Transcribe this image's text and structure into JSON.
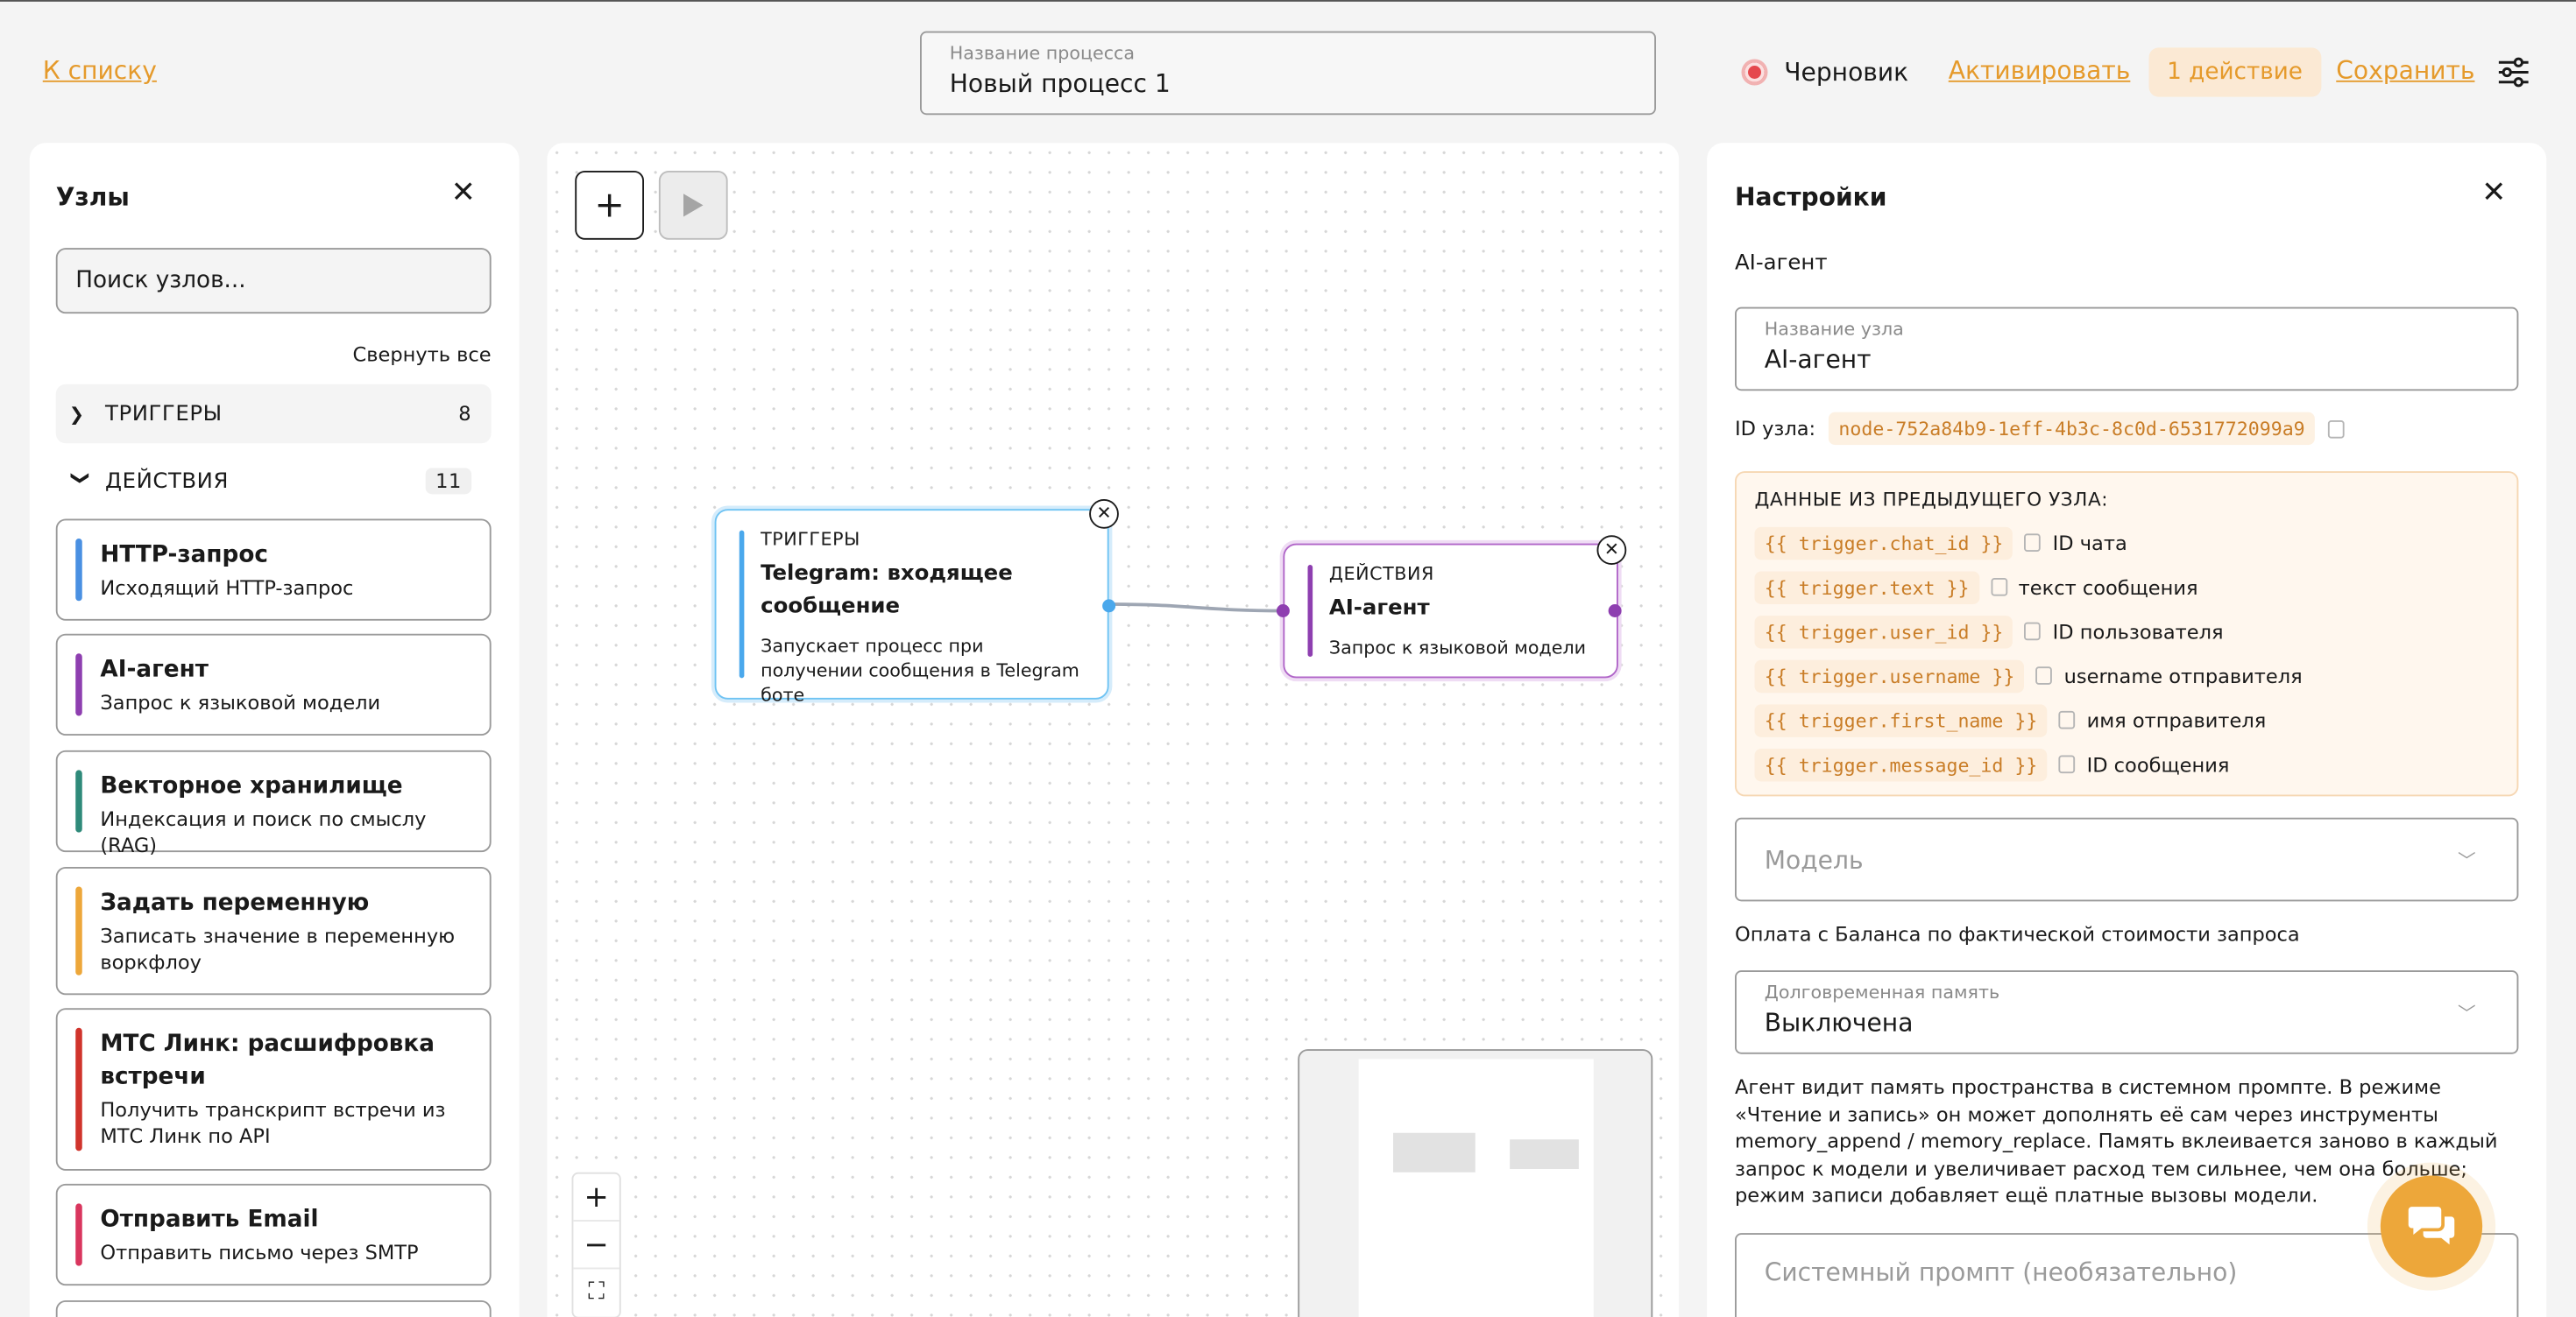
{
  "header": {
    "back_label": "К списку",
    "process_name_label": "Название процесса",
    "process_name_value": "Новый процесс 1",
    "status_label": "Черновик",
    "activate_label": "Активировать",
    "action_count_label": "1 действие",
    "save_label": "Сохранить",
    "colors": {
      "accent": "#e59a2b",
      "status_draft": "#e5484d"
    }
  },
  "nodes_panel": {
    "title": "Узлы",
    "search_placeholder": "Поиск узлов...",
    "collapse_all_label": "Свернуть все",
    "groups": [
      {
        "label": "ТРИГГЕРЫ",
        "count": "8",
        "expanded": false
      },
      {
        "label": "ДЕЙСТВИЯ",
        "count": "11",
        "expanded": true
      }
    ],
    "items": [
      {
        "title": "HTTP-запрос",
        "desc": "Исходящий HTTP-запрос",
        "color": "#4a90e2"
      },
      {
        "title": "AI-агент",
        "desc": "Запрос к языковой модели",
        "color": "#8e3fb0"
      },
      {
        "title": "Векторное хранилище",
        "desc": "Индексация и поиск по смыслу (RAG)",
        "color": "#2f8a7a"
      },
      {
        "title": "Задать переменную",
        "desc": "Записать значение в переменную воркфлоу",
        "color": "#eda73a"
      },
      {
        "title": "МТС Линк: расшифровка встречи",
        "desc": "Получить транскрипт встречи из МТС Линк по API",
        "color": "#d0342c"
      },
      {
        "title": "Отправить Email",
        "desc": "Отправить письмо через SMTP",
        "color": "#d9365e"
      }
    ]
  },
  "canvas": {
    "trigger_node": {
      "category": "ТРИГГЕРЫ",
      "title": "Telegram: входящее сообщение",
      "desc": "Запускает процесс при получении сообщения в Telegram боте",
      "color": "#4aa8ec"
    },
    "action_node": {
      "category": "ДЕЙСТВИЯ",
      "title": "AI-агент",
      "desc": "Запрос к языковой модели",
      "color": "#8e3fb0"
    }
  },
  "settings_panel": {
    "title": "Настройки",
    "node_type": "AI-агент",
    "node_name_label": "Название узла",
    "node_name_value": "AI-агент",
    "node_id_label": "ID узла:",
    "node_id_value": "node-752a84b9-1eff-4b3c-8c0d-6531772099a9",
    "prev_data_header": "ДАННЫЕ ИЗ ПРЕДЫДУЩЕГО УЗЛА:",
    "variables": [
      {
        "var": "{{ trigger.chat_id }}",
        "desc": "ID чата"
      },
      {
        "var": "{{ trigger.text }}",
        "desc": "текст сообщения"
      },
      {
        "var": "{{ trigger.user_id }}",
        "desc": "ID пользователя"
      },
      {
        "var": "{{ trigger.username }}",
        "desc": "username отправителя"
      },
      {
        "var": "{{ trigger.first_name }}",
        "desc": "имя отправителя"
      },
      {
        "var": "{{ trigger.message_id }}",
        "desc": "ID сообщения"
      }
    ],
    "model_placeholder": "Модель",
    "payment_note": "Оплата с Баланса по фактической стоимости запроса",
    "memory_label": "Долговременная память",
    "memory_value": "Выключена",
    "memory_desc": "Агент видит память пространства в системном промпте. В режиме «Чтение и запись» он может дополнять её сам через инструменты memory_append / memory_replace. Память вклеивается заново в каждый запрос к модели и увеличивает расход тем сильнее, чем она больше; режим записи добавляет ещё платные вызовы модели.",
    "system_prompt_placeholder": "Системный промпт (необязательно)"
  }
}
